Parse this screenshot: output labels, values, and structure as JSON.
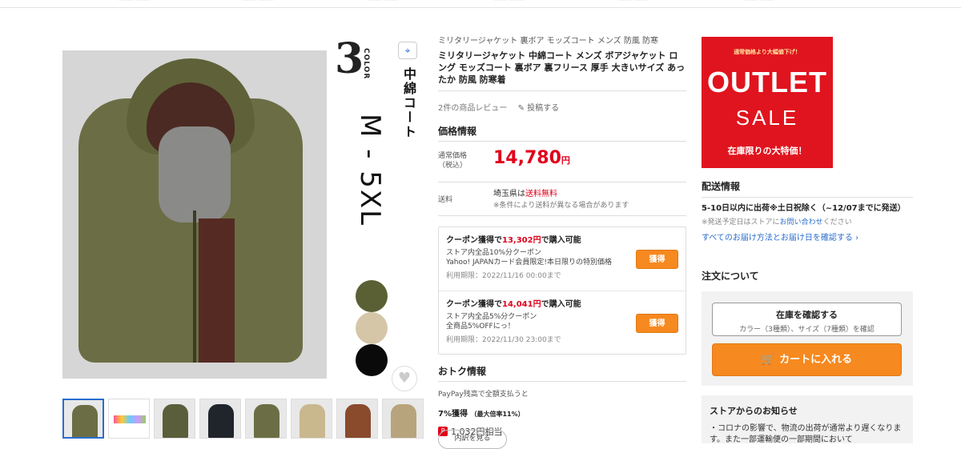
{
  "top_nav": {
    "items": [
      "—— ——",
      "—— ——",
      "—— ——",
      "—— ——",
      "—— ——",
      "—— ——"
    ]
  },
  "image": {
    "color_count": "3",
    "color_word": "COLOR",
    "coat_text": "中綿コート",
    "size_text": "M - 5XL",
    "swatches": [
      "#5a6034",
      "#d5c6a8",
      "#0a0a0a"
    ],
    "favorite_icon": "heart-icon",
    "focus_icon": "scan-icon"
  },
  "product": {
    "breadcrumb": "ミリタリージャケット 裏ボア モッズコート メンズ 防風 防寒",
    "title": "ミリタリージャケット 中綿コート メンズ ボアジャケット ロング モッズコート 裏ボア 裏フリース 厚手 大きいサイズ あったか 防風 防寒着",
    "review_text": "2件の商品レビュー",
    "post_text": "投稿する"
  },
  "price": {
    "section_title": "価格情報",
    "label_line1": "通常価格",
    "label_line2": "（税込）",
    "amount": "14,780",
    "currency": "円",
    "shipping_label": "送料",
    "shipping_pref": "埼玉県は",
    "shipping_free": "送料無料",
    "shipping_note": "※条件により送料が異なる場合があります"
  },
  "coupons": [
    {
      "head_prefix": "クーポン獲得で",
      "price": "13,302円",
      "head_suffix": "で購入可能",
      "desc1": "ストア内全品10%分クーポン",
      "desc2": "Yahoo! JAPANカード会員限定!本日限りの特別価格",
      "expiry": "利用期限：2022/11/16 00:00まで",
      "button": "獲得"
    },
    {
      "head_prefix": "クーポン獲得で",
      "price": "14,041円",
      "head_suffix": "で購入可能",
      "desc1": "ストア内全品5%分クーポン",
      "desc2": "全商品5%OFFにっ！",
      "expiry": "利用期限：2022/11/30 23:00まで",
      "button": "獲得"
    }
  ],
  "otoku": {
    "title": "おトク情報",
    "line1": "PayPay残高で全額支払うと",
    "rate": "7%獲得",
    "rate_note": "（最大倍率11%）",
    "points": "1,032円相当",
    "detail_button": "内訳を見る"
  },
  "banner": {
    "top": "通常価格より大幅値下げ！",
    "outlet": "OUTLET",
    "sale": "SALE",
    "bottom": "在庫限りの大特価！"
  },
  "delivery": {
    "title": "配送情報",
    "main": "5-10日以内に出荷※土日祝除く（~12/07までに発送）",
    "note_prefix": "※発送予定日はストアに",
    "note_link": "お問い合わせ",
    "note_suffix": "ください",
    "link": "すべてのお届け方法とお届け日を確認する"
  },
  "order": {
    "title": "注文について",
    "stock_button": "在庫を確認する",
    "stock_sub": "カラー（3種類）、サイズ（7種類）を確認",
    "cart_button": "カートに入れる"
  },
  "notice": {
    "title": "ストアからのお知らせ",
    "text": "・コロナの影響で、物流の出荷が通常より遅くなります。また一部運輸便の一部期間において"
  },
  "colors": {
    "accent_orange": "#f6891f",
    "price_red": "#e0001b",
    "link_blue": "#2a6ecf",
    "banner_red": "#e0141e"
  }
}
